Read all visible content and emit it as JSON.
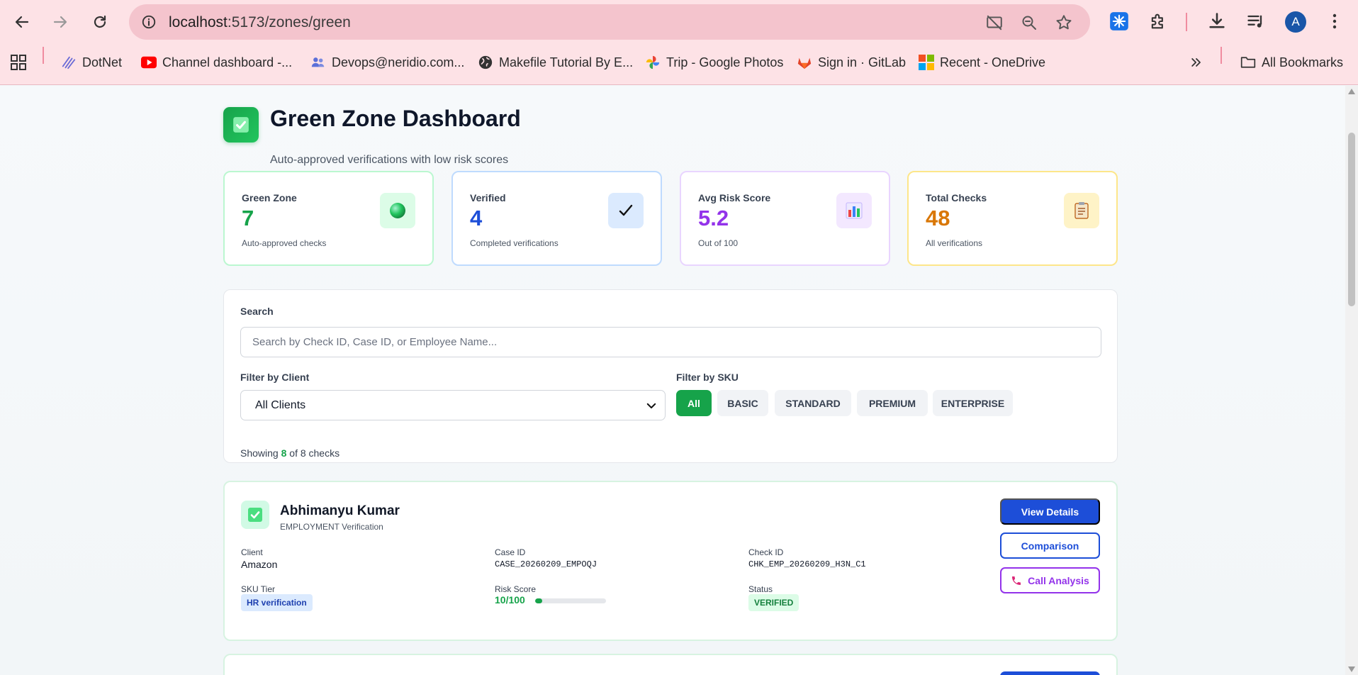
{
  "browser": {
    "url_host": "localhost",
    "url_path": ":5173/zones/green",
    "avatar_letter": "A",
    "bookmarks": [
      {
        "label": "DotNet",
        "icon": "dotnet-icon"
      },
      {
        "label": "Channel dashboard -...",
        "icon": "youtube-icon"
      },
      {
        "label": "Devops@neridio.com...",
        "icon": "people-icon"
      },
      {
        "label": "Makefile Tutorial By E...",
        "icon": "globe-icon"
      },
      {
        "label": "Trip - Google Photos",
        "icon": "google-photos-icon"
      },
      {
        "label": "Sign in · GitLab",
        "icon": "gitlab-icon"
      },
      {
        "label": "Recent - OneDrive",
        "icon": "microsoft-icon"
      }
    ],
    "all_bookmarks": "All Bookmarks"
  },
  "header": {
    "title": "Green Zone Dashboard",
    "subtitle": "Auto-approved verifications with low risk scores"
  },
  "stats": [
    {
      "label": "Green Zone",
      "value": "7",
      "desc": "Auto-approved checks",
      "color": "#16a34a",
      "border": "#bbf7d0",
      "icon_bg": "#dcfce7",
      "icon": "green-circle-icon"
    },
    {
      "label": "Verified",
      "value": "4",
      "desc": "Completed verifications",
      "color": "#1d4ed8",
      "border": "#bfdbfe",
      "icon_bg": "#dbeafe",
      "icon": "checkmark-icon"
    },
    {
      "label": "Avg Risk Score",
      "value": "5.2",
      "desc": "Out of 100",
      "color": "#9333ea",
      "border": "#e9d5ff",
      "icon_bg": "#f3e8ff",
      "icon": "bar-chart-icon"
    },
    {
      "label": "Total Checks",
      "value": "48",
      "desc": "All verifications",
      "color": "#d97706",
      "border": "#fde68a",
      "icon_bg": "#fef3c7",
      "icon": "clipboard-icon"
    }
  ],
  "filters": {
    "search_label": "Search",
    "search_placeholder": "Search by Check ID, Case ID, or Employee Name...",
    "client_label": "Filter by Client",
    "client_value": "All Clients",
    "sku_label": "Filter by SKU",
    "sku_options": [
      "All",
      "BASIC",
      "STANDARD",
      "PREMIUM",
      "ENTERPRISE"
    ],
    "showing_prefix": "Showing",
    "showing_count": "8",
    "showing_suffix": "of 8 checks"
  },
  "checks": [
    {
      "name": "Abhimanyu Kumar",
      "type": "EMPLOYMENT Verification",
      "client_label": "Client",
      "client": "Amazon",
      "case_label": "Case ID",
      "case_id": "CASE_20260209_EMPOQJ",
      "check_label": "Check ID",
      "check_id": "CHK_EMP_20260209_H3N_C1",
      "sku_label": "SKU Tier",
      "sku": "HR verification",
      "risk_label": "Risk Score",
      "risk": "10/100",
      "risk_fraction": 0.1,
      "status_label": "Status",
      "status": "VERIFIED",
      "btn_details": "View Details",
      "btn_compare": "Comparison",
      "btn_call": "Call Analysis"
    }
  ]
}
